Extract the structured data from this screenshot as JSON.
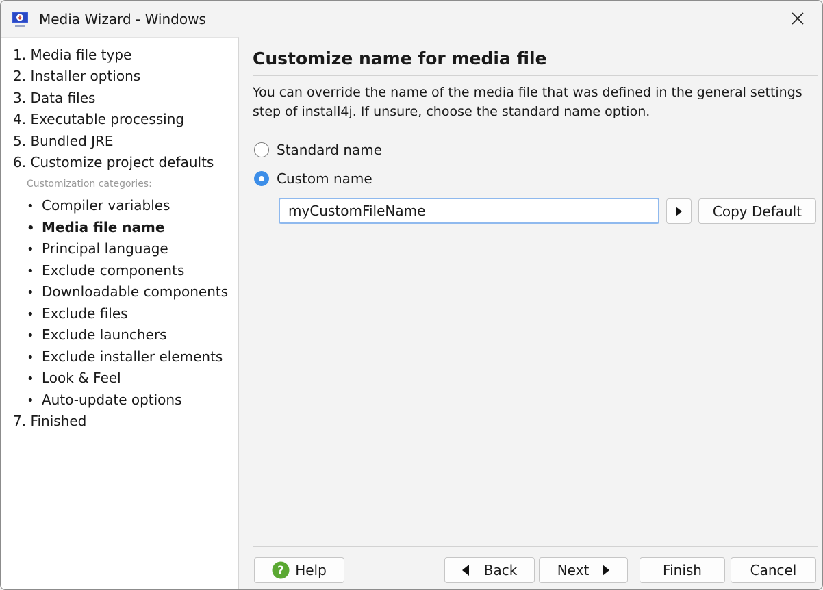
{
  "window": {
    "title": "Media Wizard - Windows"
  },
  "sidebar": {
    "steps_top": [
      "1. Media file type",
      "2. Installer options",
      "3. Data files",
      "4. Executable processing",
      "5. Bundled JRE",
      "6. Customize project defaults"
    ],
    "category_label": "Customization categories:",
    "sub_items": [
      "Compiler variables",
      "Media file name",
      "Principal language",
      "Exclude components",
      "Downloadable components",
      "Exclude files",
      "Exclude launchers",
      "Exclude installer elements",
      "Look & Feel",
      "Auto-update options"
    ],
    "active_sub": "Media file name",
    "bullet": "•",
    "step_last": "7. Finished"
  },
  "main": {
    "heading": "Customize name for media file",
    "description": "You can override the name of the media file that was defined in the general settings step of install4j. If unsure, choose the standard name option.",
    "radio_standard": "Standard name",
    "radio_custom": "Custom name",
    "selected_radio": "custom",
    "custom_name_value": "myCustomFileName",
    "copy_default": "Copy Default"
  },
  "footer": {
    "help": "Help",
    "back": "Back",
    "next": "Next",
    "finish": "Finish",
    "cancel": "Cancel"
  },
  "icons": {
    "app": "media-wizard-icon",
    "close": "close-icon",
    "help": "help-question-icon",
    "back": "triangle-left-icon",
    "next": "triangle-right-icon",
    "insert_variable": "triangle-right-icon"
  },
  "colors": {
    "accent": "#3d8ee8",
    "input_focus_border": "#8fb9ee",
    "help_green": "#5aa832"
  }
}
